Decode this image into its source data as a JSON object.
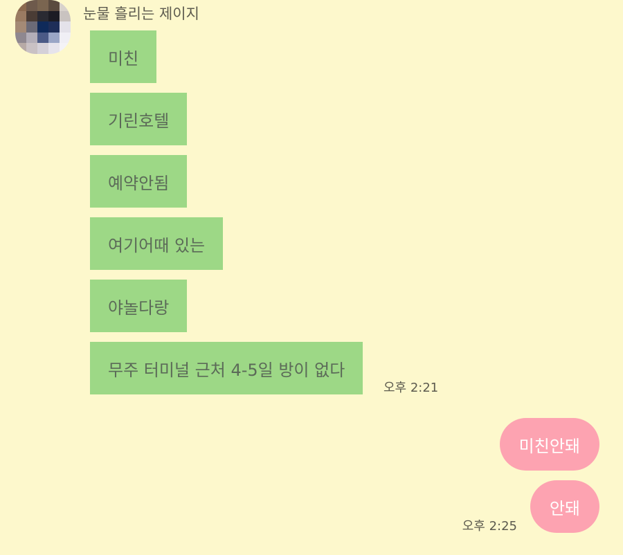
{
  "chat": {
    "sender_name": "눈물 흘리는 제이지",
    "incoming_messages": [
      "미친",
      "기린호텔",
      "예약안됨",
      "여기어때 있는",
      "야놀다랑",
      "무주 터미널 근처 4-5일 방이 없다"
    ],
    "incoming_time": "오후 2:21",
    "outgoing_messages": [
      "미친안돼",
      "안돼"
    ],
    "outgoing_time": "오후 2:25"
  },
  "colors": {
    "background": "#fdf8cc",
    "incoming_bubble": "#9dd886",
    "outgoing_bubble": "#fda3b1",
    "text_muted": "#5c5a4e"
  },
  "icons": {
    "avatar": "pixelated-profile-photo"
  }
}
